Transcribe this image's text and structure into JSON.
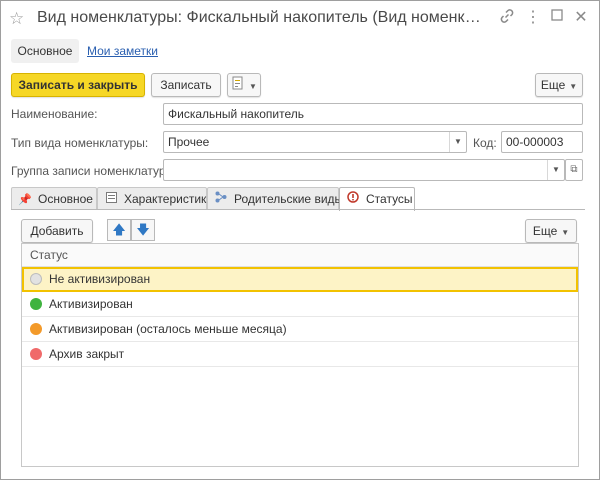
{
  "window": {
    "title": "Вид номенклатуры: Фискальный накопитель (Вид номенклатуры)",
    "icons": [
      "star-icon",
      "link-icon",
      "more-vertical-icon",
      "maximize-icon",
      "close-icon"
    ]
  },
  "section_tabs": {
    "main": "Основное",
    "notes": "Мои заметки"
  },
  "toolbar": {
    "save_close": "Записать и закрыть",
    "save": "Записать",
    "report_icon": "document-report-icon",
    "more": "Еще"
  },
  "form": {
    "name_label": "Наименование:",
    "name_value": "Фискальный накопитель",
    "type_label": "Тип вида номенклатуры:",
    "type_value": "Прочее",
    "code_label": "Код:",
    "code_value": "00-000003",
    "group_label": "Группа записи номенклатуры:",
    "group_value": ""
  },
  "tabs": [
    {
      "label": "Основное",
      "icon": "pin-icon",
      "active": false
    },
    {
      "label": "Характеристики",
      "icon": "list-icon",
      "active": false
    },
    {
      "label": "Родительские виды",
      "icon": "hierarchy-icon",
      "active": false
    },
    {
      "label": "Статусы",
      "icon": "status-icon",
      "active": true
    }
  ],
  "statuses": {
    "add_button": "Добавить",
    "more": "Еще",
    "column_header": "Статус",
    "rows": [
      {
        "label": "Не активизирован",
        "color": "#e2e2e2",
        "selected": true
      },
      {
        "label": "Активизирован",
        "color": "#3fb33f",
        "selected": false
      },
      {
        "label": "Активизирован (осталось меньше месяца)",
        "color": "#f39a2a",
        "selected": false
      },
      {
        "label": "Архив закрыт",
        "color": "#f06a6a",
        "selected": false
      }
    ]
  },
  "colors": {
    "accent_yellow": "#f6d726",
    "link_blue": "#2a5fb0",
    "selection_bg": "#fdf3c6",
    "selection_border": "#f2c200"
  }
}
